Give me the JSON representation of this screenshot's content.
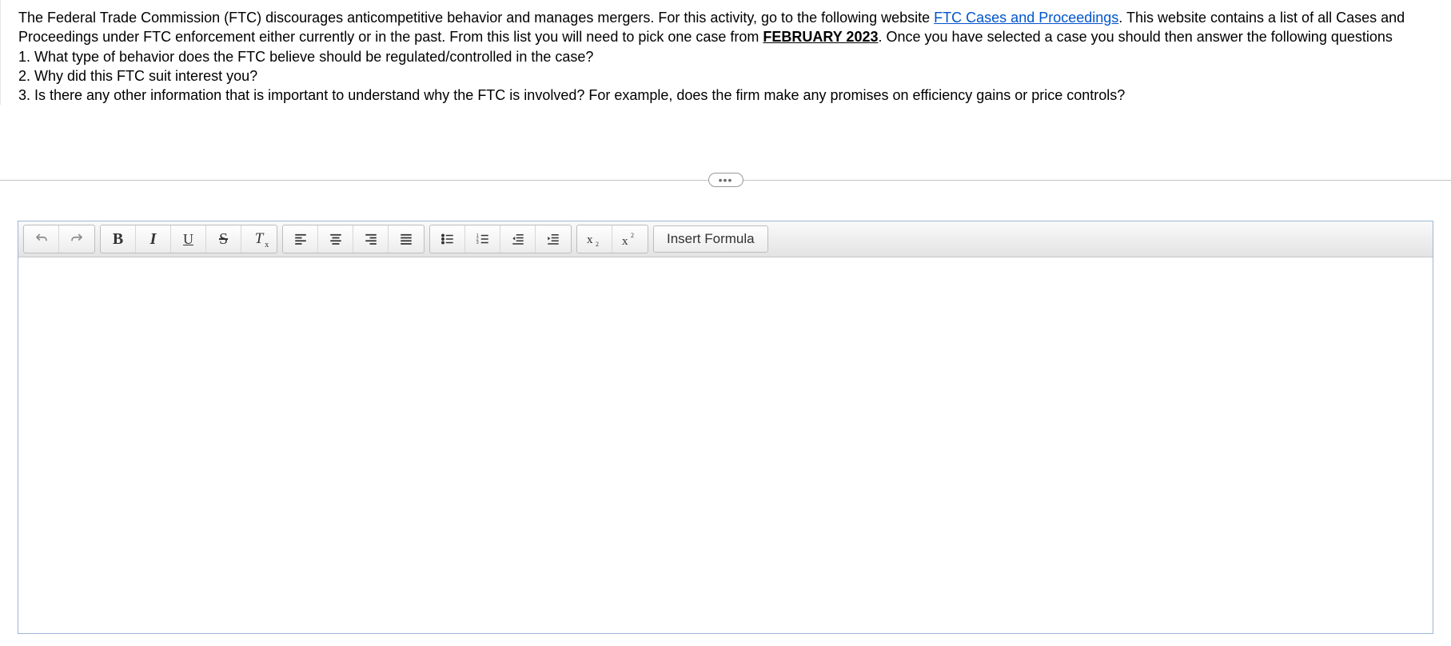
{
  "prompt": {
    "p1_a": "The Federal Trade Commission (FTC) discourages anticompetitive behavior and manages mergers.  For this activity, go to the following website ",
    "link_text": "FTC Cases and Proceedings",
    "p1_b": ". This website contains a list of all Cases and Proceedings under FTC enforcement either currently or in the past.  From this list you will need to pick one case from ",
    "bold": "FEBRUARY 2023",
    "p1_c": ".  Once you have selected a case you should then answer the following questions",
    "q1": "1. What type of behavior does the FTC believe should be regulated/controlled in the case?",
    "q2": "2. Why did this FTC suit interest you?",
    "q3": "3. Is there any other information that is important to understand why the FTC is involved? For example, does the firm make any promises on efficiency gains or price controls?"
  },
  "divider": {
    "dots": "•••"
  },
  "toolbar": {
    "bold": "B",
    "italic": "I",
    "underline": "U",
    "strike": "S",
    "removefmt": "T",
    "insert_formula": "Insert Formula"
  }
}
